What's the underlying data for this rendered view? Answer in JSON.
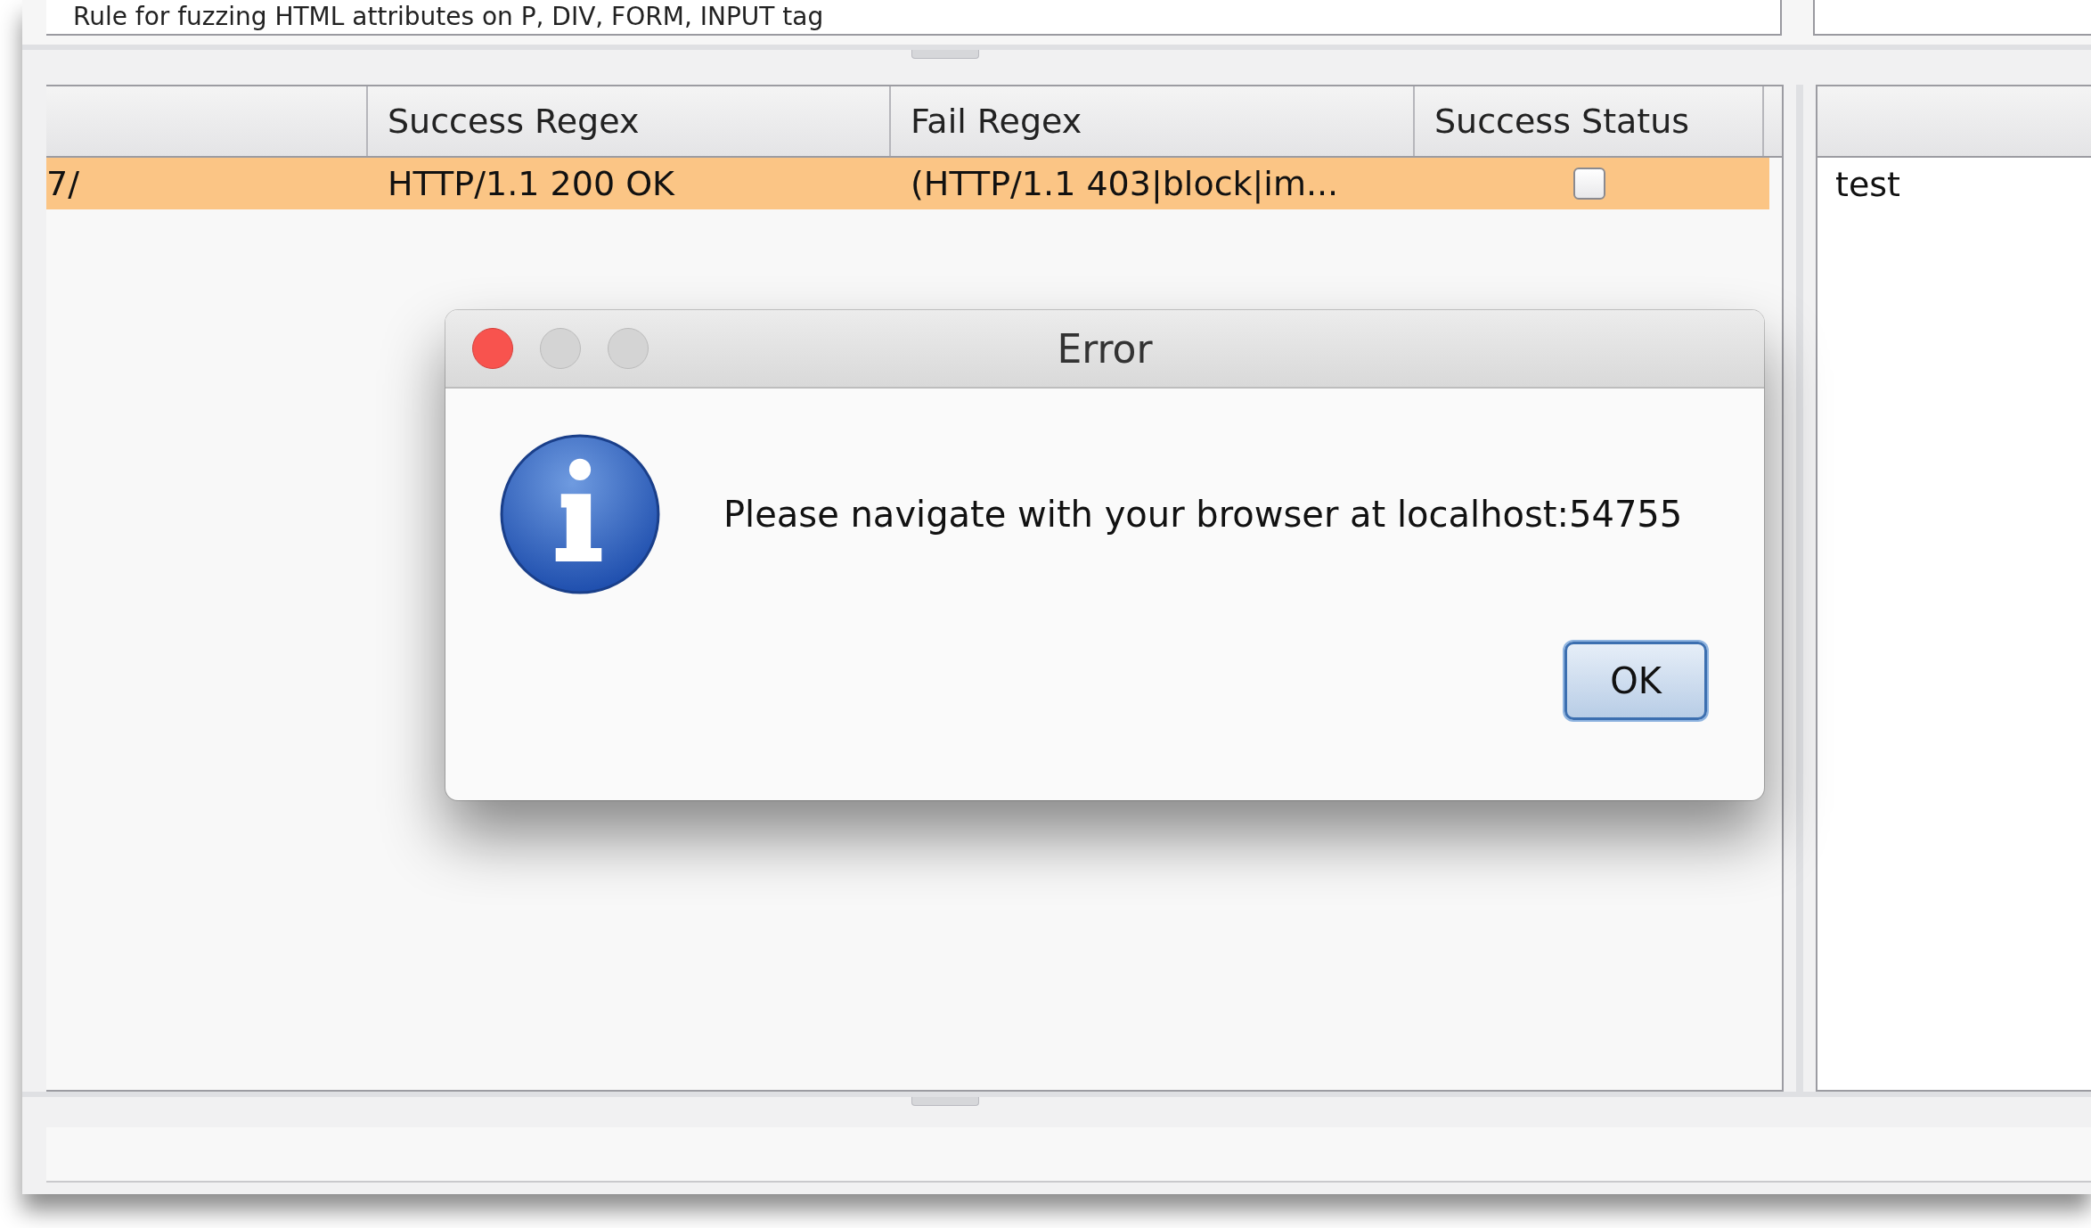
{
  "top_field": {
    "text": "Rule for fuzzing HTML attributes on P, DIV, FORM, INPUT tag"
  },
  "table": {
    "columns": [
      "",
      "Success Regex",
      "Fail Regex",
      "Success Status"
    ],
    "rows": [
      {
        "cells": [
          "7/",
          "HTTP/1.1 200 OK",
          "(HTTP/1.1 403|block|im..."
        ],
        "checked": false,
        "selected": true
      }
    ]
  },
  "side_list": {
    "rows": [
      "test"
    ]
  },
  "dialog": {
    "title": "Error",
    "message": "Please navigate with your browser at localhost:54755",
    "buttons": [
      "OK"
    ]
  }
}
